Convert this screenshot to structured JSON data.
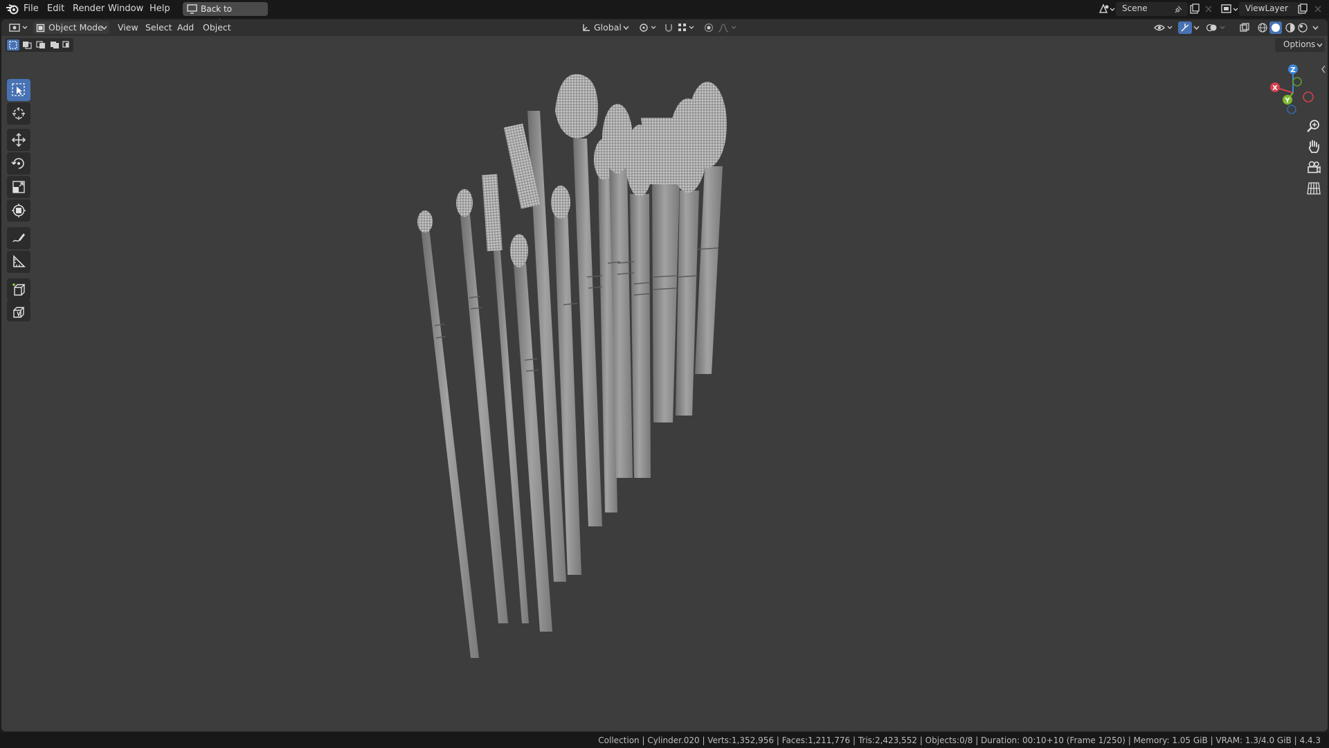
{
  "topbar": {
    "menus": [
      "File",
      "Edit",
      "Render",
      "Window",
      "Help"
    ],
    "back_button": "Back to Previous",
    "scene_name": "Scene",
    "view_layer": "ViewLayer"
  },
  "header": {
    "mode": "Object Mode",
    "menus": [
      "View",
      "Select",
      "Add",
      "Object"
    ],
    "orientation": "Global",
    "options": "Options"
  },
  "toolbar": {
    "tools": [
      "select-box",
      "cursor",
      "move",
      "rotate",
      "scale",
      "transform",
      "annotate",
      "measure",
      "add-cube",
      "add-primitive"
    ]
  },
  "status": {
    "text": "Collection | Cylinder.020 | Verts:1,352,956 | Faces:1,211,776 | Tris:2,423,552 | Objects:0/8 | Duration: 00:10+10 (Frame 1/250) | Memory: 1.05 GiB | VRAM: 1.3/4.0 GiB | 4.4.3"
  },
  "gizmo": {
    "x": "X",
    "y": "Y",
    "z": "Z"
  },
  "colors": {
    "accent": "#4772b3",
    "x_axis": "#d5404f",
    "y_axis": "#7dbb2e",
    "z_axis": "#3f87d6"
  }
}
